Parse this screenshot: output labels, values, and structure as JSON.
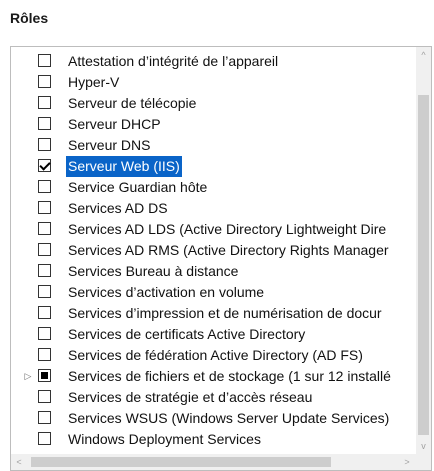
{
  "header": {
    "title": "Rôles"
  },
  "roles": [
    {
      "label": "Attestation d’intégrité de l’appareil",
      "state": "unchecked",
      "expandable": false,
      "selected": false
    },
    {
      "label": "Hyper-V",
      "state": "unchecked",
      "expandable": false,
      "selected": false
    },
    {
      "label": "Serveur de télécopie",
      "state": "unchecked",
      "expandable": false,
      "selected": false
    },
    {
      "label": "Serveur DHCP",
      "state": "unchecked",
      "expandable": false,
      "selected": false
    },
    {
      "label": "Serveur DNS",
      "state": "unchecked",
      "expandable": false,
      "selected": false
    },
    {
      "label": "Serveur Web (IIS)",
      "state": "checked",
      "expandable": false,
      "selected": true
    },
    {
      "label": "Service Guardian hôte",
      "state": "unchecked",
      "expandable": false,
      "selected": false
    },
    {
      "label": "Services AD DS",
      "state": "unchecked",
      "expandable": false,
      "selected": false
    },
    {
      "label": "Services AD LDS (Active Directory Lightweight Dire",
      "state": "unchecked",
      "expandable": false,
      "selected": false
    },
    {
      "label": "Services AD RMS (Active Directory Rights Manager",
      "state": "unchecked",
      "expandable": false,
      "selected": false
    },
    {
      "label": "Services Bureau à distance",
      "state": "unchecked",
      "expandable": false,
      "selected": false
    },
    {
      "label": "Services d’activation en volume",
      "state": "unchecked",
      "expandable": false,
      "selected": false
    },
    {
      "label": "Services d’impression et de numérisation de docur",
      "state": "unchecked",
      "expandable": false,
      "selected": false
    },
    {
      "label": "Services de certificats Active Directory",
      "state": "unchecked",
      "expandable": false,
      "selected": false
    },
    {
      "label": "Services de fédération Active Directory (AD FS)",
      "state": "unchecked",
      "expandable": false,
      "selected": false
    },
    {
      "label": "Services de fichiers et de stockage (1 sur 12 installé",
      "state": "partial",
      "expandable": true,
      "selected": false
    },
    {
      "label": "Services de stratégie et d’accès réseau",
      "state": "unchecked",
      "expandable": false,
      "selected": false
    },
    {
      "label": "Services WSUS (Windows Server Update Services)",
      "state": "unchecked",
      "expandable": false,
      "selected": false
    },
    {
      "label": "Windows Deployment Services",
      "state": "unchecked",
      "expandable": false,
      "selected": false
    }
  ],
  "icons": {
    "expander": "▷",
    "scroll_up": "^",
    "scroll_down": "v",
    "scroll_left": "<",
    "scroll_right": ">"
  },
  "colors": {
    "selection": "#0a64c8"
  }
}
